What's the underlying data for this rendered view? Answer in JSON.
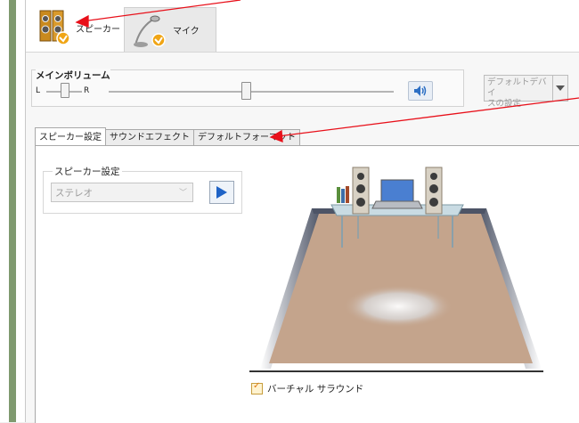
{
  "device_tabs": [
    {
      "label": "スピーカー",
      "icon": "speaker-device-icon"
    },
    {
      "label": "マイク",
      "icon": "microphone-device-icon"
    }
  ],
  "volume": {
    "title": "メインボリューム",
    "left": "L",
    "right": "R",
    "balance": 0.5,
    "level": 0.48,
    "mute_icon": "speaker-volume-icon"
  },
  "default_device": {
    "line1": "デフォルトデバイ",
    "line2": "スの設定"
  },
  "tabs": [
    "スピーカー設定",
    "サウンドエフェクト",
    "デフォルトフォーマット"
  ],
  "speaker_settings": {
    "title": "スピーカー設定",
    "value": "ステレオ"
  },
  "virtual_surround": {
    "label": "バーチャル サラウンド",
    "checked": true
  },
  "colors": {
    "annotation_arrow": "#e8101a",
    "floor": "#c4a48c",
    "wall": "#5a6172",
    "frame_green": "#7f9a6f"
  }
}
